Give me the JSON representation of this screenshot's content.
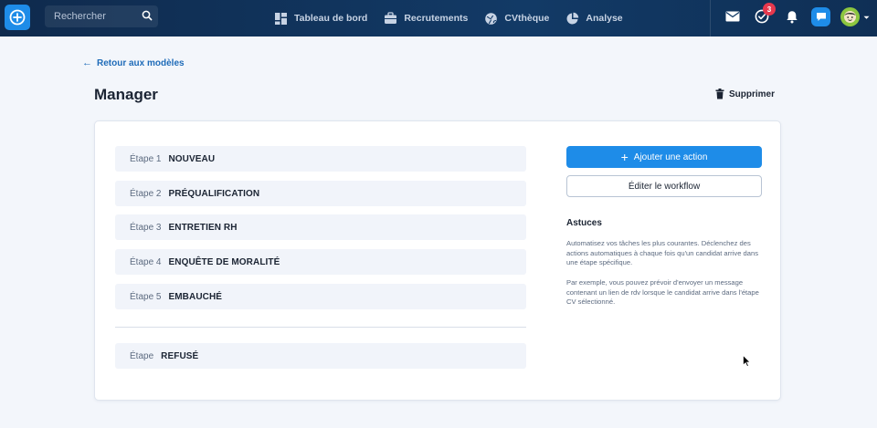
{
  "topbar": {
    "search_placeholder": "Rechercher",
    "nav": [
      {
        "label": "Tableau de bord",
        "icon": "dashboard-icon"
      },
      {
        "label": "Recrutements",
        "icon": "briefcase-icon"
      },
      {
        "label": "CVthèque",
        "icon": "globe-icon"
      },
      {
        "label": "Analyse",
        "icon": "chart-icon"
      }
    ],
    "tasks_badge": "3"
  },
  "page": {
    "back_label": "Retour aux modèles",
    "title": "Manager",
    "delete_label": "Supprimer"
  },
  "steps": [
    {
      "label": "Étape 1",
      "name": "NOUVEAU"
    },
    {
      "label": "Étape 2",
      "name": "PRÉQUALIFICATION"
    },
    {
      "label": "Étape 3",
      "name": "ENTRETIEN RH"
    },
    {
      "label": "Étape 4",
      "name": "ENQUÊTE DE MORALITÉ"
    },
    {
      "label": "Étape 5",
      "name": "EMBAUCHÉ"
    }
  ],
  "rejected_step": {
    "label": "Étape",
    "name": "REFUSÉ"
  },
  "actions": {
    "add_action": "Ajouter une action",
    "edit_workflow": "Éditer le workflow"
  },
  "tips": {
    "title": "Astuces",
    "paragraph1": "Automatisez vos tâches les plus courantes. Déclenchez des actions automatiques à chaque fois qu'un candidat arrive dans une étape spécifique.",
    "paragraph2": "Par exemple, vous pouvez prévoir d'envoyer un message contenant un lien de rdv lorsque le candidat arrive dans l'étape CV sélectionné."
  },
  "colors": {
    "topbar": "#123a66",
    "accent": "#1e8ce8",
    "badge": "#e5384d",
    "avatar": "#8cc63f",
    "step_bg": "#f1f4fa"
  }
}
